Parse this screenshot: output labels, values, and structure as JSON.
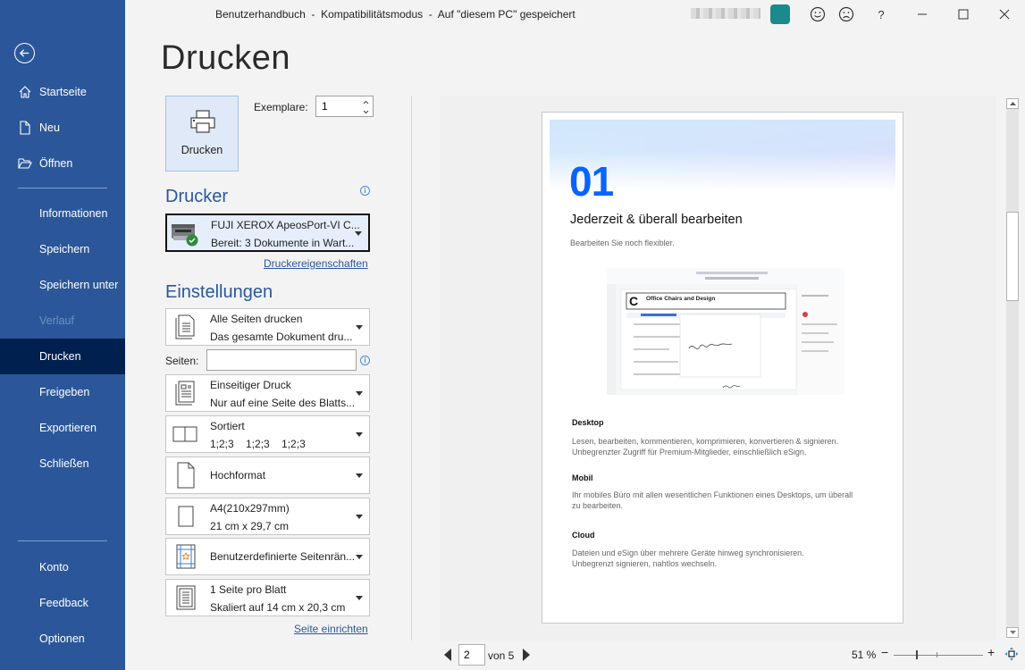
{
  "window": {
    "title": "Benutzerhandbuch  -  Kompatibilitätsmodus  -  Auf \"diesem PC\" gespeichert",
    "help_label": "?",
    "minimize_label": "–",
    "close_label": "✕"
  },
  "sidebar": {
    "items": [
      {
        "label": "Startseite",
        "icon": "home-icon"
      },
      {
        "label": "Neu",
        "icon": "new-document-icon"
      },
      {
        "label": "Öffnen",
        "icon": "folder-open-icon"
      },
      {
        "label": "Informationen"
      },
      {
        "label": "Speichern"
      },
      {
        "label": "Speichern unter"
      },
      {
        "label": "Verlauf",
        "disabled": true
      },
      {
        "label": "Drucken",
        "active": true
      },
      {
        "label": "Freigeben"
      },
      {
        "label": "Exportieren"
      },
      {
        "label": "Schließen"
      },
      {
        "label": "Konto"
      },
      {
        "label": "Feedback"
      },
      {
        "label": "Optionen"
      }
    ]
  },
  "main": {
    "title": "Drucken",
    "print_button_label": "Drucken",
    "copies_label": "Exemplare:",
    "copies_value": "1",
    "printer_section": "Drucker",
    "printer": {
      "name": "FUJI XEROX ApeosPort-VI C...",
      "status": "Bereit: 3 Dokumente in Wart..."
    },
    "printer_properties_link": "Druckereigenschaften",
    "settings_section": "Einstellungen",
    "pages_label": "Seiten:",
    "pages_value": "",
    "settings": [
      {
        "line1": "Alle Seiten drucken",
        "line2": "Das gesamte Dokument dru...",
        "icon": "pages-icon"
      },
      {
        "line1": "Einseitiger Druck",
        "line2": "Nur auf eine Seite des Blatts...",
        "icon": "one-sided-icon"
      },
      {
        "line1": "Sortiert",
        "line2": "1;2;3    1;2;3    1;2;3",
        "icon": "collated-icon"
      },
      {
        "line1": "Hochformat",
        "line2": "",
        "icon": "portrait-icon"
      },
      {
        "line1": "A4(210x297mm)",
        "line2": "21 cm x 29,7 cm",
        "icon": "paper-size-icon"
      },
      {
        "line1": "Benutzerdefinierte Seitenrän...",
        "line2": "",
        "icon": "margins-icon"
      },
      {
        "line1": "1 Seite pro Blatt",
        "line2": "Skaliert auf 14 cm x 20,3 cm",
        "icon": "pages-per-sheet-icon"
      }
    ],
    "page_setup_link": "Seite einrichten"
  },
  "preview": {
    "number": "01",
    "heading": "Jederzeit & überall bearbeiten",
    "subheading": "Bearbeiten Sie noch flexibler.",
    "screenshot_title": "Office Chairs and Design",
    "sections": [
      {
        "title": "Desktop",
        "text": "Lesen, bearbeiten, kommentieren, komprimieren, konvertieren & signieren. Unbegrenzter Zugriff für Premium-Mitglieder, einschließlich eSign."
      },
      {
        "title": "Mobil",
        "text": "Ihr mobiles Büro mit allen wesentlichen Funktionen eines Desktops, um überall zu bearbeiten."
      },
      {
        "title": "Cloud",
        "text": "Dateien und eSign über mehrere Geräte hinweg synchronisieren. Unbegrenzt signieren, nahtlos wechseln."
      }
    ]
  },
  "footer": {
    "current_page": "2",
    "of_label": "von 5",
    "zoom_label": "51 %",
    "zoom_minus": "−",
    "zoom_plus": "+",
    "zoom_percent": 51
  },
  "colors": {
    "sidebar": "#2b579a",
    "sidebar_active": "#002050",
    "accent": "#2b579a",
    "preview_number": "#0a63ff"
  }
}
